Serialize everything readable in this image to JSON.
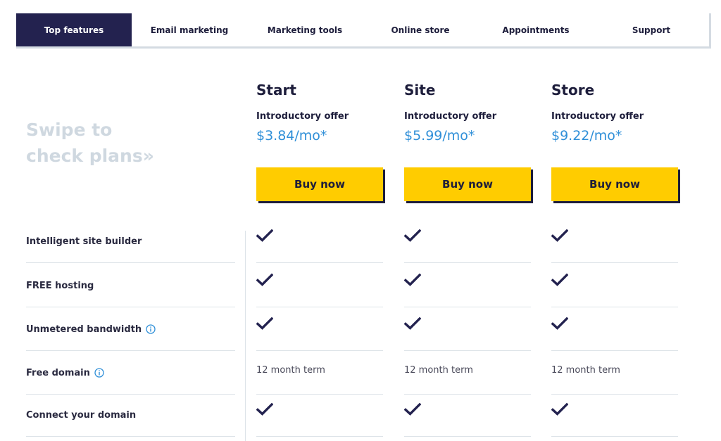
{
  "tabs": [
    {
      "label": "Top features",
      "active": true
    },
    {
      "label": "Email marketing",
      "active": false
    },
    {
      "label": "Marketing tools",
      "active": false
    },
    {
      "label": "Online store",
      "active": false
    },
    {
      "label": "Appointments",
      "active": false
    },
    {
      "label": "Support",
      "active": false
    }
  ],
  "swipe_text": "Swipe to\ncheck plans»",
  "plans": [
    {
      "name": "Start",
      "intro": "Introductory offer",
      "price": "$3.84/mo*",
      "button": "Buy now"
    },
    {
      "name": "Site",
      "intro": "Introductory offer",
      "price": "$5.99/mo*",
      "button": "Buy now"
    },
    {
      "name": "Store",
      "intro": "Introductory offer",
      "price": "$9.22/mo*",
      "button": "Buy now"
    }
  ],
  "features": [
    {
      "label": "Intelligent site builder",
      "info": false,
      "values": [
        "check",
        "check",
        "check"
      ]
    },
    {
      "label": "FREE hosting",
      "info": false,
      "values": [
        "check",
        "check",
        "check"
      ]
    },
    {
      "label": "Unmetered bandwidth",
      "info": true,
      "values": [
        "check",
        "check",
        "check"
      ]
    },
    {
      "label": "Free domain",
      "info": true,
      "values": [
        "12 month term",
        "12 month term",
        "12 month term"
      ]
    },
    {
      "label": "Connect your domain",
      "info": false,
      "values": [
        "check",
        "check",
        "check"
      ]
    }
  ],
  "icons": {
    "check": "checkmark-icon",
    "info": "info-icon"
  },
  "colors": {
    "navy": "#23224f",
    "accent_yellow": "#ffcc00",
    "price_blue": "#2f8fd8",
    "swipe_gray": "#cfd8e0"
  }
}
